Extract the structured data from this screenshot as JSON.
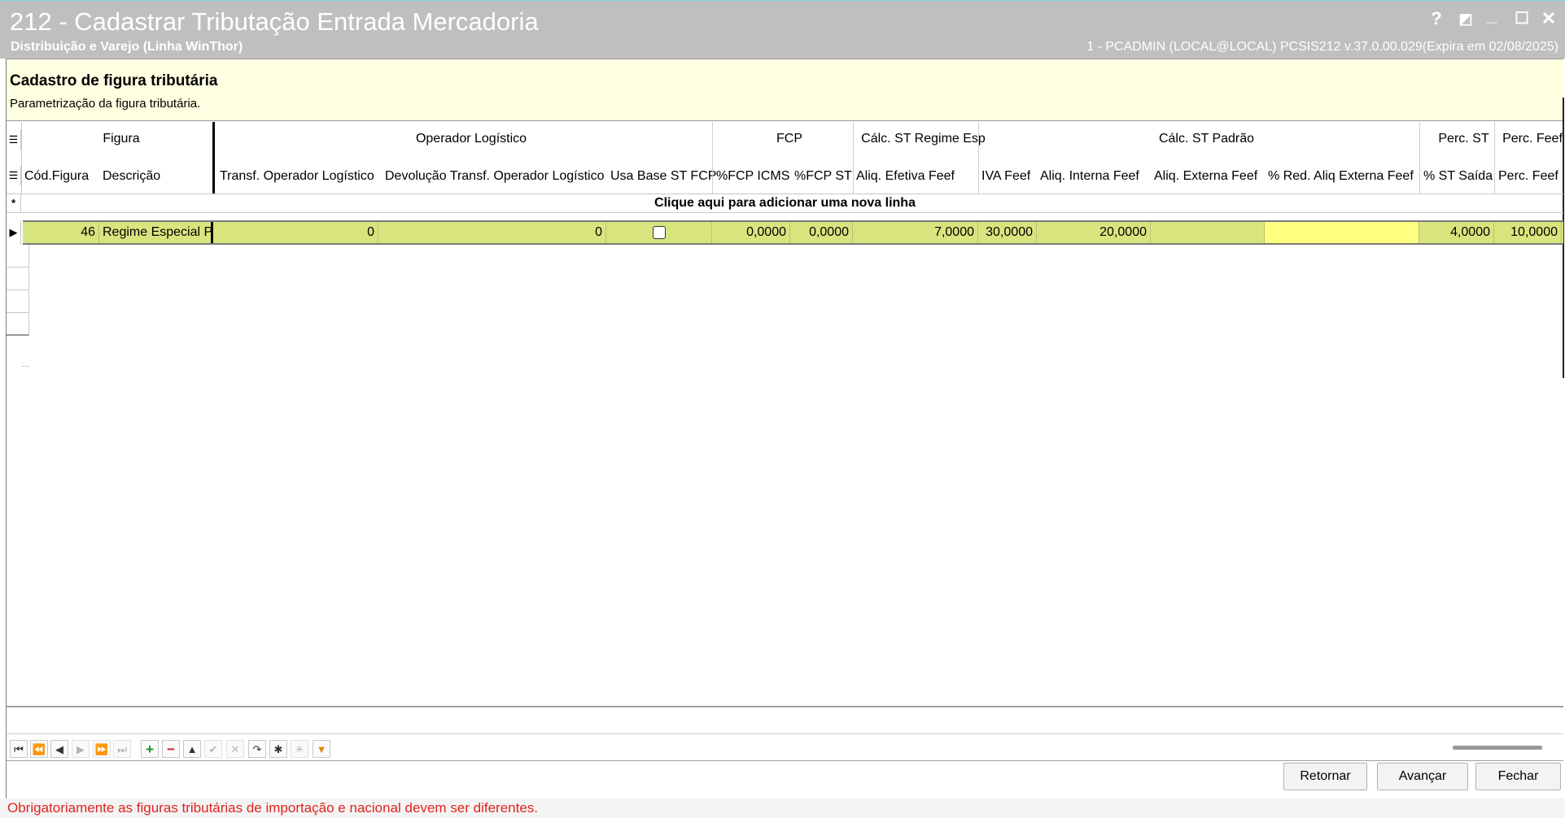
{
  "window": {
    "title": "212 - Cadastrar Tributação Entrada Mercadoria",
    "subtitle": "Distribuição e Varejo (Linha WinThor)",
    "session": "1 - PCADMIN (LOCAL@LOCAL)   PCSIS212  v.37.0.00.029(Expira em 02/08/2025)",
    "buttons": {
      "help": "?",
      "edit": "◩",
      "minimize": "_",
      "maximize": "☐",
      "close": "✕"
    }
  },
  "info": {
    "title": "Cadastro de figura tributária",
    "description": "Parametrização da figura tributária."
  },
  "grid": {
    "bands": [
      "Figura",
      "Operador Logístico",
      "FCP",
      "Cálc. ST Regime Esp",
      "Cálc. ST Padrão",
      "Perc. ST",
      "Perc. Feef"
    ],
    "columns": [
      "Cód.Figura",
      "Descrição",
      "Transf. Operador Logístico",
      "Devolução Transf. Operador Logístico",
      "Usa Base ST FCP",
      "%FCP ICMS",
      "%FCP ST",
      "Aliq. Efetiva Feef",
      "IVA Feef",
      "Aliq. Interna Feef",
      "Aliq. Externa Feef",
      "% Red. Aliq Externa Feef",
      "% ST Saída",
      "Perc. Feef"
    ],
    "add_row_text": "Clique aqui para adicionar uma nova linha",
    "rows": [
      {
        "cod": "46",
        "descricao": "Regime Especial PB",
        "transf": "0",
        "devolucao": "0",
        "usa_base": false,
        "fcp_icms": "0,0000",
        "fcp_st": "0,0000",
        "aliq_efetiva": "7,0000",
        "iva": "30,0000",
        "aliq_interna": "20,0000",
        "aliq_externa": "",
        "red_aliq": "",
        "st_saida": "4,0000",
        "perc_feef": "10,0000"
      }
    ]
  },
  "navigator": {
    "icons": [
      "first-icon",
      "prev-page-icon",
      "prev-icon",
      "next-icon",
      "next-page-icon",
      "last-icon",
      "add-icon",
      "delete-icon",
      "up-icon",
      "post-icon",
      "cancel-icon",
      "refresh-icon",
      "bookmark-icon",
      "goto-bookmark-icon",
      "filter-icon"
    ]
  },
  "buttons": {
    "retornar": "Retornar",
    "avancar": "Avançar",
    "fechar": "Fechar"
  },
  "status_message": "Obrigatoriamente as figuras tributárias de importação e nacional devem ser diferentes.",
  "colors": {
    "selected_row": "#d8e57e",
    "highlight_cell": "#ffff80",
    "info_bg": "#ffffe1",
    "error_text": "#e0241c"
  }
}
